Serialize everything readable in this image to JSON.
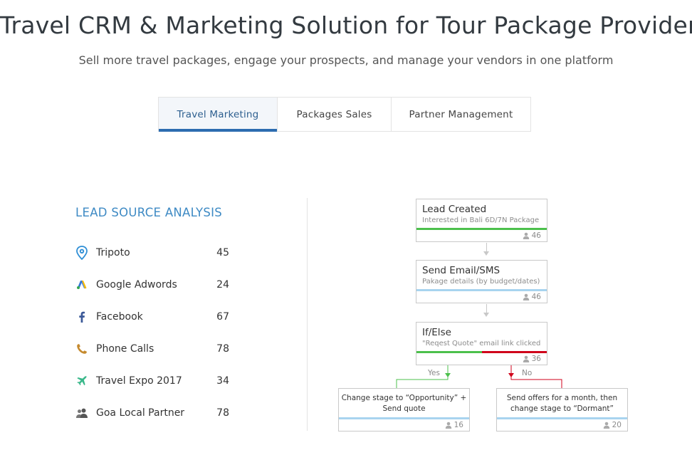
{
  "page": {
    "title": "Travel CRM & Marketing Solution for Tour Package Providers",
    "subtitle": "Sell more travel packages, engage your prospects, and manage your vendors in one platform"
  },
  "tabs": [
    {
      "label": "Travel Marketing",
      "active": true
    },
    {
      "label": "Packages Sales",
      "active": false
    },
    {
      "label": "Partner Management",
      "active": false
    }
  ],
  "lead_source": {
    "heading": "LEAD SOURCE ANALYSIS",
    "items": [
      {
        "label": "Tripoto",
        "value": "45",
        "icon": "tripoto-pin-icon"
      },
      {
        "label": "Google Adwords",
        "value": "24",
        "icon": "google-adwords-icon"
      },
      {
        "label": "Facebook",
        "value": "67",
        "icon": "facebook-icon"
      },
      {
        "label": "Phone Calls",
        "value": "78",
        "icon": "phone-icon"
      },
      {
        "label": "Travel Expo 2017",
        "value": "34",
        "icon": "airplane-icon"
      },
      {
        "label": "Goa Local Partner",
        "value": "78",
        "icon": "people-icon"
      }
    ]
  },
  "workflow": {
    "lead_created": {
      "title": "Lead Created",
      "desc": "Interested in Bali 6D/7N Package",
      "count": "46"
    },
    "send_email": {
      "title": "Send Email/SMS",
      "desc": "Pakage details (by budget/dates)",
      "count": "46"
    },
    "if_else": {
      "title": "If/Else",
      "desc": "\"Reqest Quote\" email link clicked",
      "count": "36"
    },
    "yes_label": "Yes",
    "no_label": "No",
    "yes_action": {
      "text": "Change stage to “Opportunity” + Send quote",
      "count": "16"
    },
    "no_action": {
      "text": "Send offers for a month, then change stage to “Dormant”",
      "count": "20"
    }
  },
  "colors": {
    "accent_blue": "#2d6cb0",
    "heading_blue": "#3e8ac4",
    "green": "#4cc04c",
    "red": "#d0021b",
    "light_blue_bar": "#a8d4ef"
  }
}
